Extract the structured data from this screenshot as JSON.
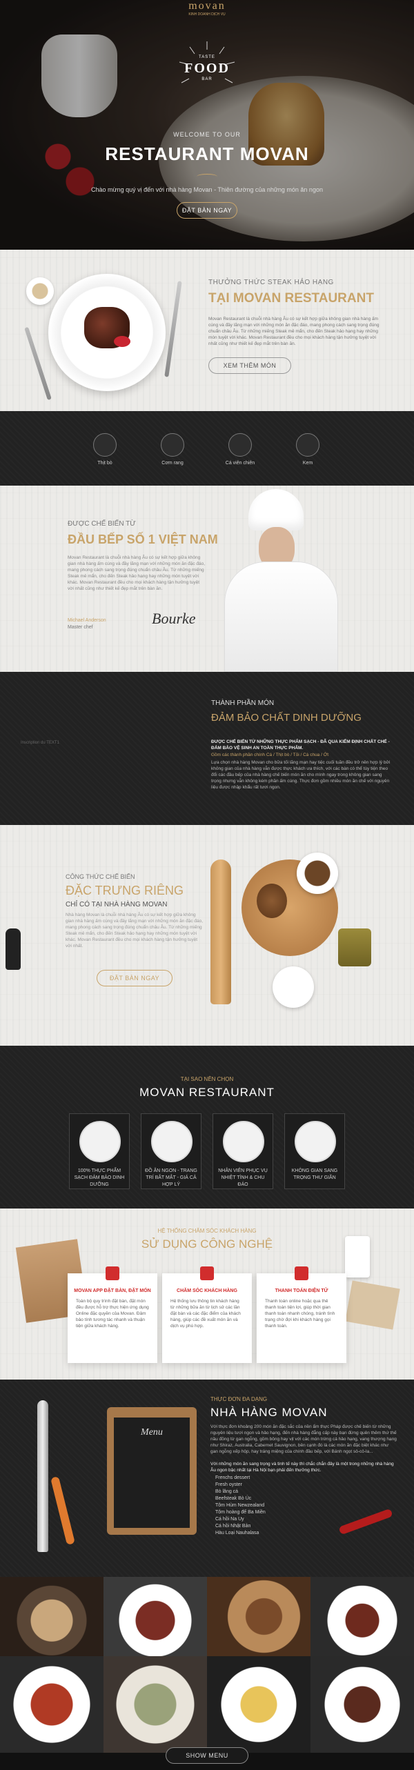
{
  "colors": {
    "accent": "#c8a46a",
    "dark": "#232323",
    "red": "#d12d2d"
  },
  "hero": {
    "brand": "movan",
    "brand_sub": "KINH DOANH DỊCH VỤ",
    "badge_top": "TASTE",
    "badge_main": "FOOD",
    "badge_bottom": "BAR",
    "welcome": "WELCOME TO OUR",
    "title": "RESTAURANT MOVAN",
    "subtitle": "Chào mừng  quý vị đến với nhà hàng Movan - Thiên đường của những món ăn ngon",
    "cta": "ĐẶT BÀN NGAY"
  },
  "intro": {
    "kicker": "THƯỞNG THỨC STEAK HẢO HẠNG",
    "title": "TẠI MOVAN RESTAURANT",
    "body": "Movan Restaurant là chuỗi nhà hàng Âu có sự kết hợp giữa không gian nhà hàng ấm cúng và đầy lãng mạn với những món ăn đặc đáo, mang phong cách sang trọng đúng chuẩn châu Âu. Từ những miếng Steak mê mẩn, cho đến Steak hảo hạng hay những món tuyệt vời khác. Movan Restaurant đều cho mọi khách hàng tận hưởng tuyệt vời nhất cũng như thiết kế đẹp mắt trên bàn ăn.",
    "cta": "XEM THÊM MÓN"
  },
  "categories": [
    {
      "label": "Thịt bò",
      "icon": "beef-icon"
    },
    {
      "label": "Cơm rang",
      "icon": "rice-bowl-icon"
    },
    {
      "label": "Cá viên chiên",
      "icon": "fish-icon"
    },
    {
      "label": "Kem",
      "icon": "ice-cream-icon"
    }
  ],
  "chef": {
    "kicker": "ĐƯỢC CHẾ BIẾN TỪ",
    "title": "ĐẦU BẾP SỐ 1 VIỆT NAM",
    "body": "Movan Restaurant là chuỗi nhà hàng Âu có sự kết hợp giữa không gian nhà hàng ấm cúng và đầy lãng mạn với những món ăn đặc đáo, mang phong cách sang trọng đúng chuẩn châu Âu. Từ những miếng Steak mê mẩn, cho đến Steak hảo hạng hay những món tuyệt vời khác. Movan Restaurant đều cho mọi khách hàng tận hưởng tuyệt vời nhất cũng như thiết kế đẹp mắt trên bàn ăn.",
    "name": "Michael Anderson",
    "role": "Master chef",
    "signature": "Bourke"
  },
  "dish": {
    "kicker": "THÀNH PHẦN MÓN",
    "title": "ĐẢM BẢO CHẤT DINH DƯỠNG",
    "lead": "ĐƯỢC CHẾ BIẾN TỪ NHỮNG THỰC PHẨM SẠCH - ĐÃ QUA KIỂM ĐỊNH CHẤT CHẾ - ĐẢM BẢO VỆ SINH AN TOÀN THỰC PHẨM.",
    "ingredients": "Gồm các thành phần chính Cá / Thịt bò / Tỏi / Cà chua / Ớt",
    "body": "Lựa chọn nhà hàng Movan cho bữa tối lãng mạn hay tiệc cuối tuần đều trở nên hợp lý bởi không gian của nhà hàng vẫn được thực khách ưa thích, với các bàn có thể tùy tiện theo đổi các đầu bếp của nhà hàng chế biến món ăn cho mình ngay trong không gian sang trọng nhưng vẫn không kém phần ấm cúng. Thực đơn gồm nhiều món ăn chế với nguyên liệu được nhập khẩu rất tươi ngon.",
    "placeholder": "Inscription du TEXT1"
  },
  "recipe": {
    "kicker": "CÔNG THỨC CHẾ BIẾN",
    "title": "ĐẶC TRƯNG RIÊNG",
    "sub": "CHỈ CÓ TẠI NHÀ HÀNG MOVAN",
    "body": "Nhà hàng Movan là chuỗi nhà hàng Âu có sự kết hợp giữa không gian nhà hàng ấm cúng và đầy lãng mạn với những món ăn đặc đáo, mang phong cách sang trọng đúng chuẩn châu Âu. Từ những miếng Steak mê mẩn, cho đến Steak hảo hạng hay những món tuyệt vời khác. Movan Restaurant đều cho mọi khách hàng tận hưởng tuyệt vời nhất.",
    "cta": "ĐẶT BÀN NGAY"
  },
  "why": {
    "kicker": "TẠI SAO NÊN CHỌN",
    "title": "MOVAN RESTAURANT",
    "items": [
      {
        "text": "100% THỰC PHẨM SẠCH ĐẢM BẢO DINH DƯỠNG"
      },
      {
        "text": "ĐỒ ĂN NGON - TRANG TRÍ BẮT MẮT - GIÁ CẢ HỢP LÝ"
      },
      {
        "text": "NHÂN VIÊN PHỤC VỤ NHIỆT TÌNH & CHU ĐÁO"
      },
      {
        "text": "KHÔNG GIAN SANG TRỌNG THƯ GIÃN"
      }
    ]
  },
  "tech": {
    "kicker": "HỆ THỐNG CHĂM SÓC KHÁCH HÀNG",
    "title": "SỬ DỤNG CÔNG NGHỆ",
    "cards": [
      {
        "title": "MOVAN APP ĐẶT BÀN, ĐẶT MÓN",
        "text": "Toàn bộ quy trình đặt bàn, đặt món đều được hỗ trợ thực hiện ứng dụng Online đặc quyền của Movan. Đảm bảo tính tương tác nhanh và thuận tiện giữa khách hàng."
      },
      {
        "title": "CHĂM SÓC KHÁCH HÀNG",
        "text": "Hệ thống lưu thông tin khách hàng từ những bữa ăn từ lịch sử các lần đặt bàn và các đặc điểm của khách hàng, giúp các đề xuất món ăn và dịch vụ phù hợp."
      },
      {
        "title": "THANH TOÁN ĐIỆN TỬ",
        "text": "Thanh toán online hoặc qua thẻ thanh toán tiện lợi, giúp thời gian thanh toán nhanh chóng, tránh tình trạng chờ đợi khi khách hàng gọi thanh toán."
      }
    ]
  },
  "menu": {
    "kicker": "THỰC ĐƠN ĐA DẠNG",
    "title": "NHÀ HÀNG MOVAN",
    "board": "Menu",
    "body1": "Với thực đơn khoảng 200 món ăn đặc sắc của nền ẩm thực Pháp được chế biến từ những nguyên liệu tươi ngon và hảo hạng, đến nhà hàng đẳng cấp này bạn đừng quên thêm thứ thế nầu đồng từ gan ngỗng, gồm bông hay vịt với các món trứng cá hảo hạng, vang thượng hạng như Shiraz, Australia, Cabernet Sauvignon, bên cạnh đó là các món ăn đặc biệt khác như gan ngỗng xếp hộp, hay tráng miệng của chính đầu bếp, với Bánh ngọt sô-cô-la...",
    "body2": "Với những món ăn sang trọng và tinh tế này thì chắc chắn đây là một trong những nhà hàng Âu ngon bậc nhất tại Hà Nội bạn phải đến thưởng thức.",
    "items": [
      "Frenchs dessert",
      "Fresh oyster",
      "Bò lăng cá",
      "Beefsteak Bò Úc",
      "Tôm Hùm Newzealand",
      "Tôm hoàng đế Ba Miền",
      "Cá hồi Na Uy",
      "Cá hồi Nhật Bản",
      "Hàu Loại Nauhalasa"
    ]
  },
  "gallery": {
    "cta": "SHOW MENU"
  }
}
